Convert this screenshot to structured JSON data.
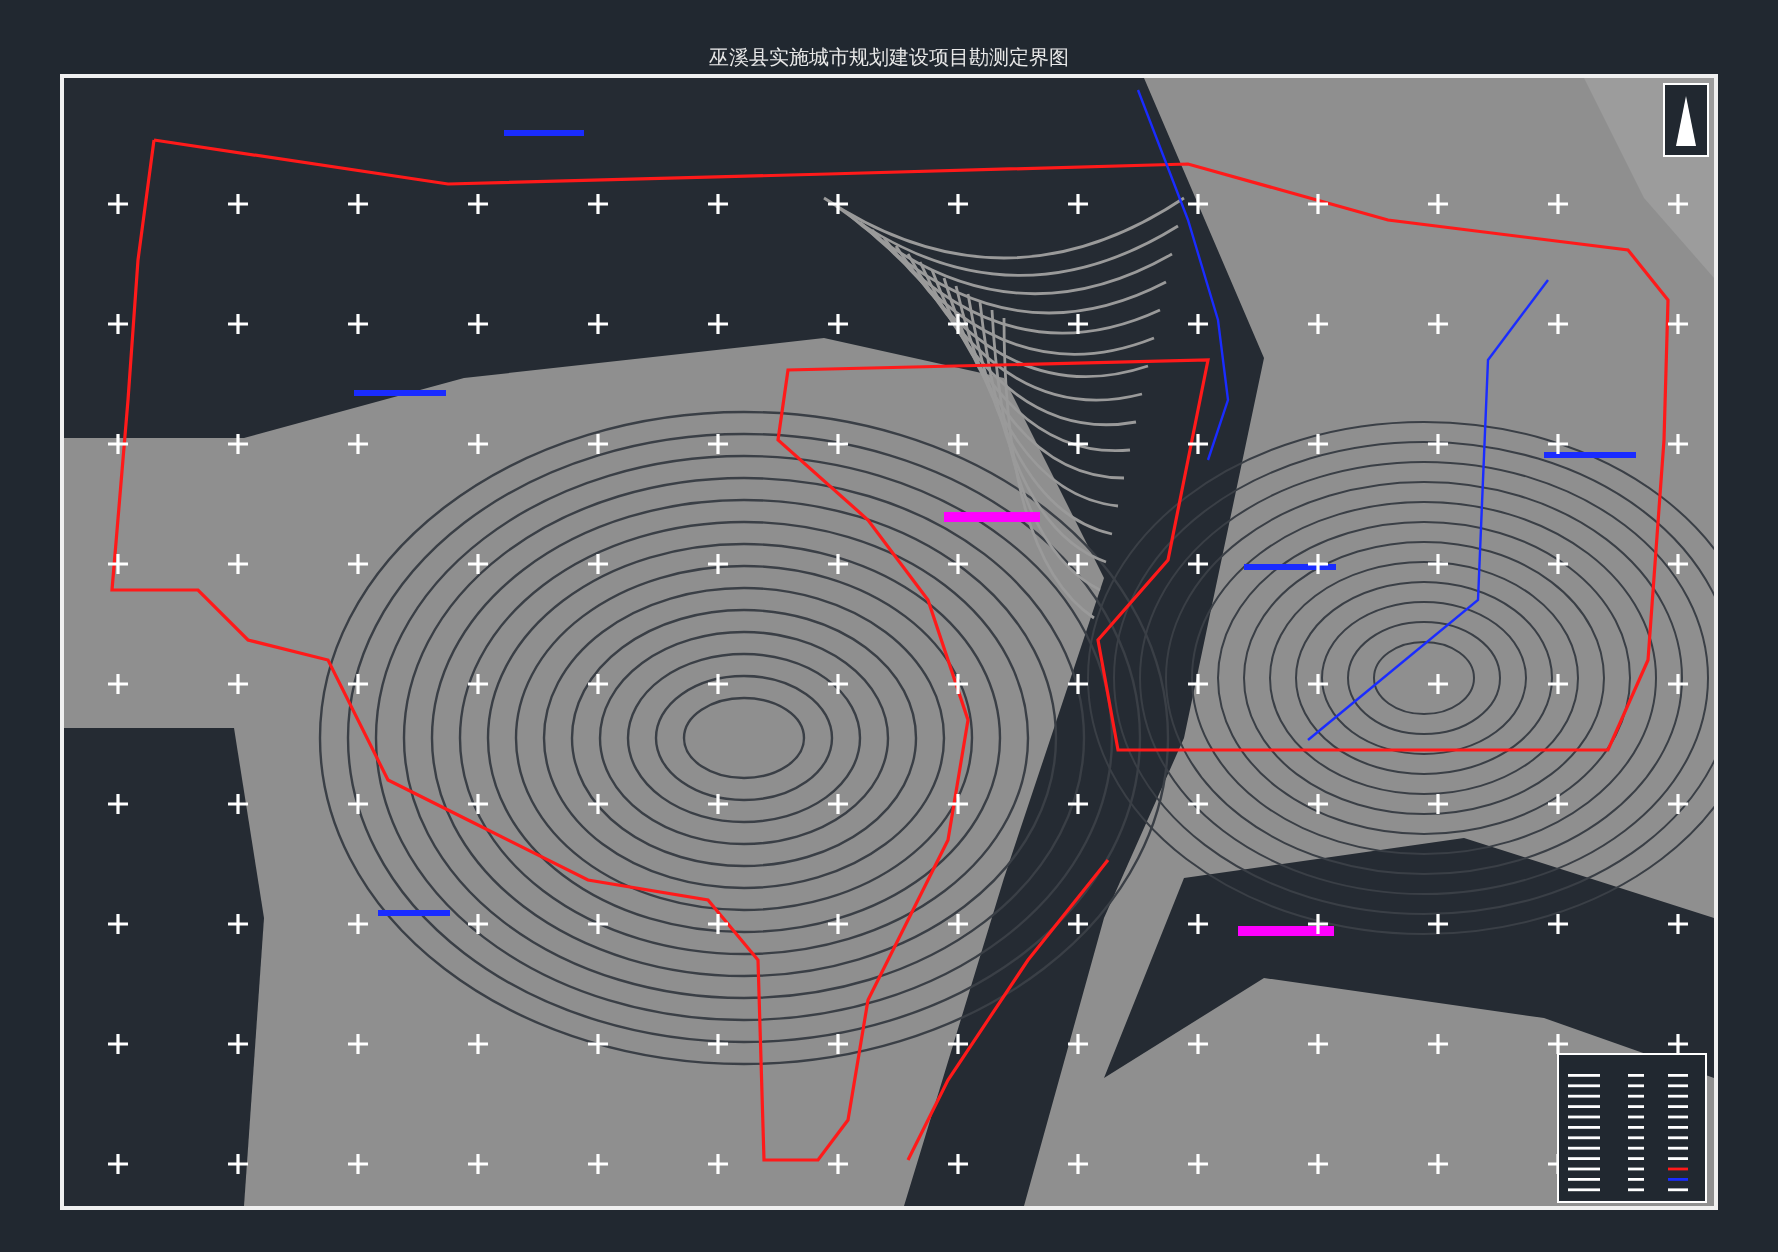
{
  "title": "巫溪县实施城市规划建设项目勘测定界图"
}
